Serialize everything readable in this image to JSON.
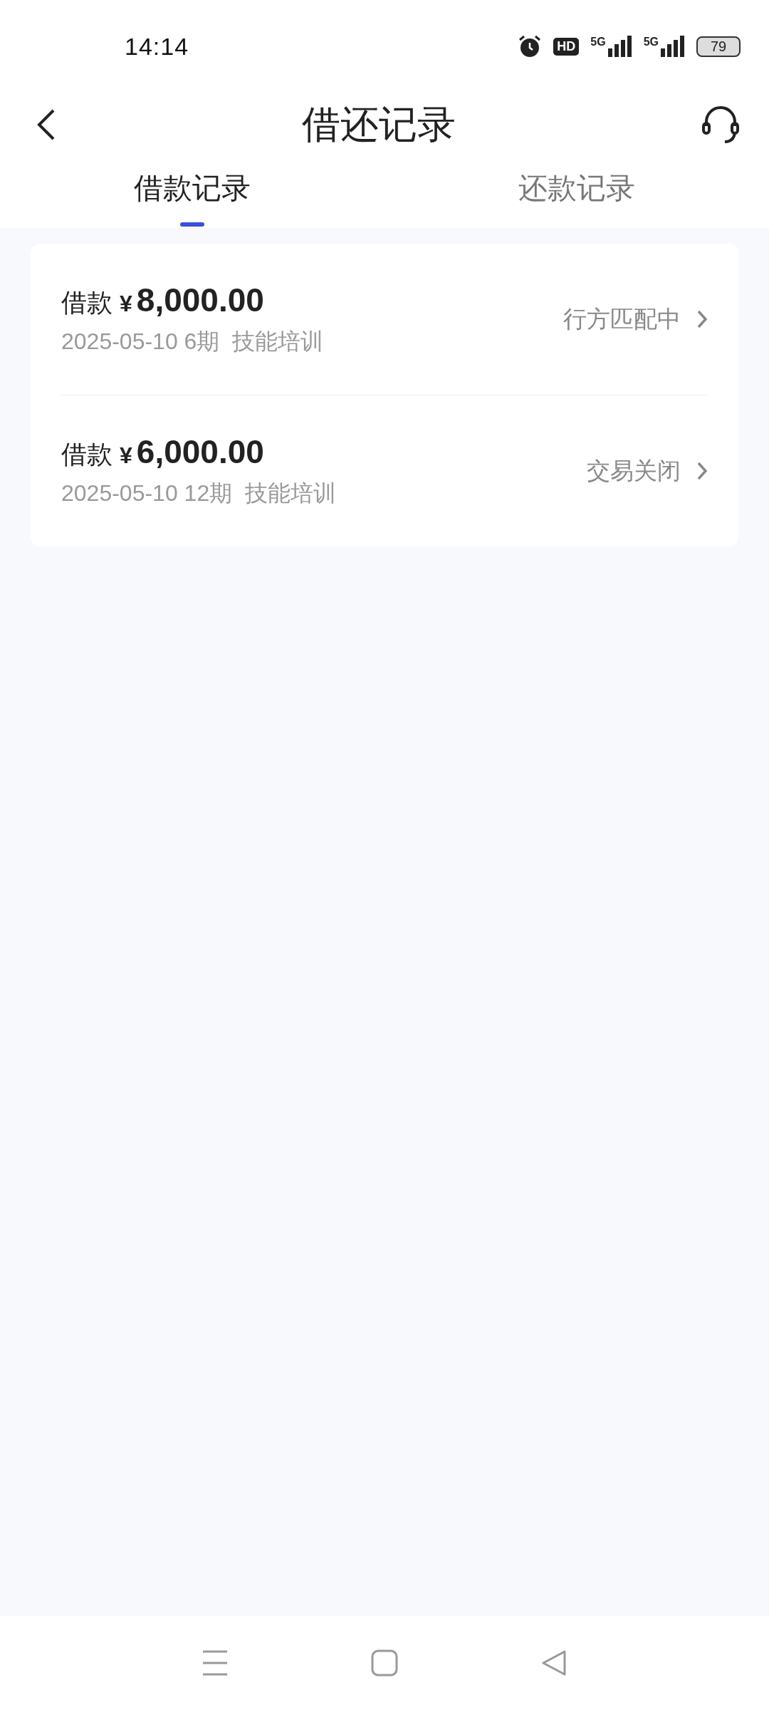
{
  "status_bar": {
    "time": "14:14",
    "hd": "HD",
    "networks": [
      "5G",
      "5G"
    ],
    "battery": "79"
  },
  "header": {
    "title": "借还记录"
  },
  "tabs": [
    {
      "label": "借款记录",
      "selected": true
    },
    {
      "label": "还款记录",
      "selected": false
    }
  ],
  "records": [
    {
      "label": "借款",
      "currency": "¥",
      "amount": "8,000.00",
      "date_term": "2025-05-10 6期",
      "purpose": "技能培训",
      "status": "行方匹配中"
    },
    {
      "label": "借款",
      "currency": "¥",
      "amount": "6,000.00",
      "date_term": "2025-05-10 12期",
      "purpose": "技能培训",
      "status": "交易关闭"
    }
  ]
}
